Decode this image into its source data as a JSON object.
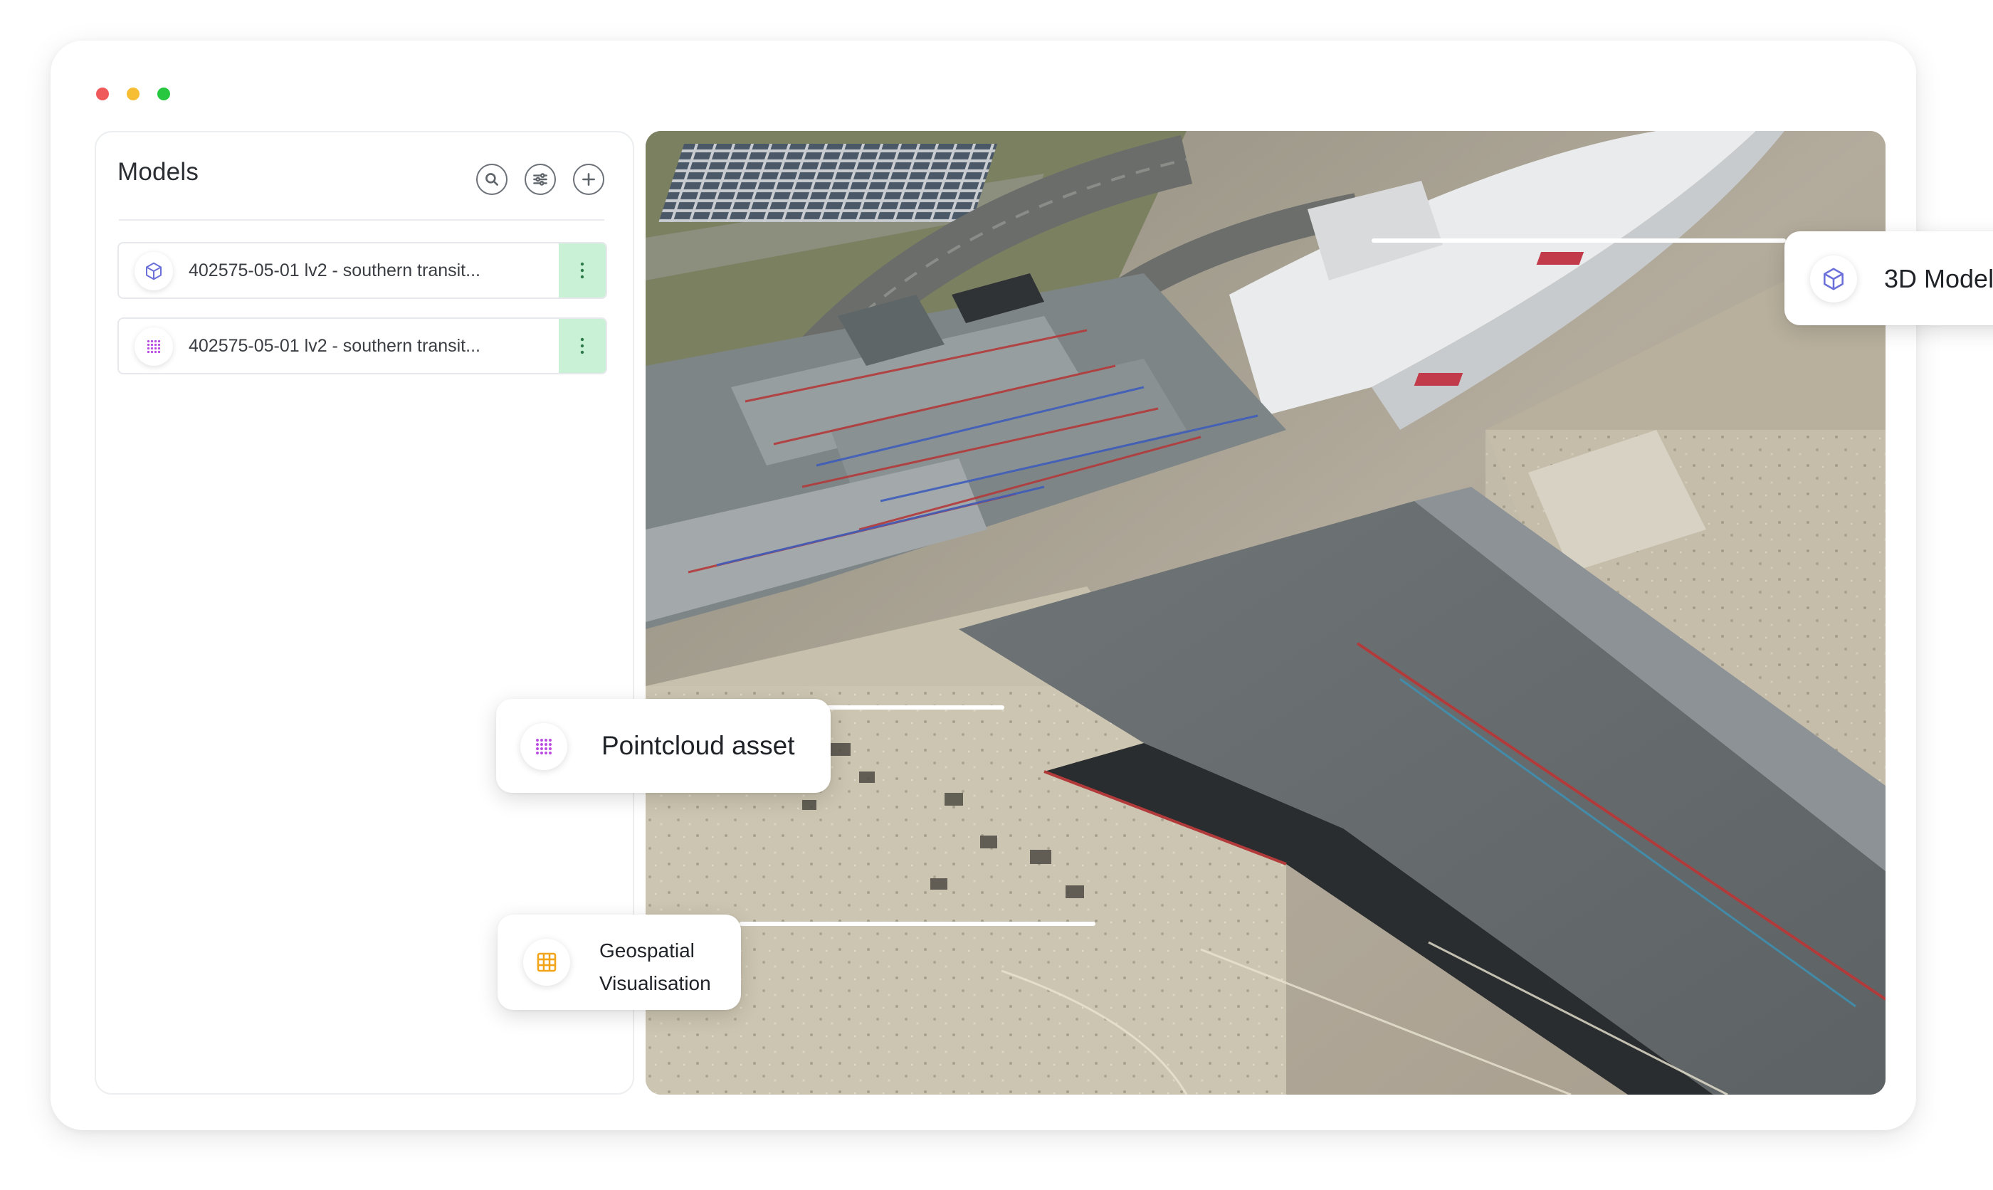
{
  "window": {
    "traffic_lights": [
      "close",
      "minimize",
      "maximize"
    ],
    "colors": {
      "close": "#f0595a",
      "minimize": "#f7bd33",
      "maximize": "#27c840"
    }
  },
  "models_panel": {
    "title": "Models",
    "tools": [
      {
        "name": "search",
        "icon": "search-icon"
      },
      {
        "name": "filter",
        "icon": "sliders-icon"
      },
      {
        "name": "add",
        "icon": "plus-circle-icon"
      }
    ],
    "items": [
      {
        "label": "402575-05-01 lv2 - southern transit...",
        "icon": "cube-icon",
        "menu_icon": "kebab-icon"
      },
      {
        "label": "402575-05-01 lv2 - southern transit...",
        "icon": "pointcloud-icon",
        "menu_icon": "kebab-icon"
      }
    ],
    "accent_color": "#c8f1d5"
  },
  "viewport": {
    "description_icon": "3d-scene",
    "callouts": {
      "model3d": {
        "label": "3D Model",
        "icon": "cube-icon",
        "icon_color": "#6b6fd9"
      },
      "pointcloud": {
        "label": "Pointcloud asset",
        "icon": "pointcloud-icon",
        "icon_color": "#b94be0"
      },
      "geo": {
        "line1": "Geospatial",
        "line2": "Visualisation",
        "icon": "map-grid-icon",
        "icon_color": "#f2a51a"
      }
    }
  }
}
